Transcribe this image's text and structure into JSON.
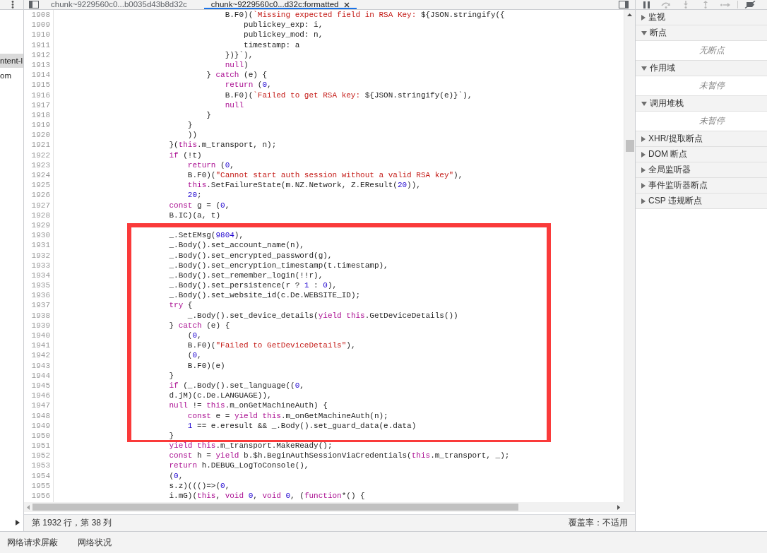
{
  "navigator": {
    "items": [
      {
        "label": "ntent-l",
        "selected": true
      },
      {
        "label": "om",
        "selected": false
      }
    ]
  },
  "editor": {
    "tabs": [
      {
        "label": "chunk~9229560c0...b0035d43b8d32c",
        "selected": false
      },
      {
        "label": "chunk~9229560c0...d32c:formatted",
        "selected": true
      }
    ],
    "lines": [
      {
        "number": "1908",
        "tokens": [
          {
            "kind": "plain",
            "text": "\t\t\t\t\t\t\t\t\tB.F0)("
          },
          {
            "kind": "string",
            "text": "`Missing expected field in RSA Key: "
          },
          {
            "kind": "plain",
            "text": "${JSON.stringify({"
          }
        ]
      },
      {
        "number": "1909",
        "tokens": [
          {
            "kind": "plain",
            "text": "\t\t\t\t\t\t\t\t\t\tpublickey_exp: i,"
          }
        ]
      },
      {
        "number": "1910",
        "tokens": [
          {
            "kind": "plain",
            "text": "\t\t\t\t\t\t\t\t\t\tpublickey_mod: n,"
          }
        ]
      },
      {
        "number": "1911",
        "tokens": [
          {
            "kind": "plain",
            "text": "\t\t\t\t\t\t\t\t\t\ttimestamp: a"
          }
        ]
      },
      {
        "number": "1912",
        "tokens": [
          {
            "kind": "plain",
            "text": "\t\t\t\t\t\t\t\t\t})}`),"
          }
        ]
      },
      {
        "number": "1913",
        "tokens": [
          {
            "kind": "keyword",
            "text": "\t\t\t\t\t\t\t\t\tnull"
          },
          {
            "kind": "plain",
            "text": ")"
          }
        ]
      },
      {
        "number": "1914",
        "tokens": [
          {
            "kind": "plain",
            "text": "\t\t\t\t\t\t\t\t} "
          },
          {
            "kind": "keyword",
            "text": "catch"
          },
          {
            "kind": "plain",
            "text": " (e) {"
          }
        ]
      },
      {
        "number": "1915",
        "tokens": [
          {
            "kind": "keyword",
            "text": "\t\t\t\t\t\t\t\t\treturn"
          },
          {
            "kind": "plain",
            "text": " ("
          },
          {
            "kind": "number",
            "text": "0"
          },
          {
            "kind": "plain",
            "text": ","
          }
        ]
      },
      {
        "number": "1916",
        "tokens": [
          {
            "kind": "plain",
            "text": "\t\t\t\t\t\t\t\t\tB.F0)("
          },
          {
            "kind": "string",
            "text": "`Failed to get RSA key: "
          },
          {
            "kind": "plain",
            "text": "${JSON.stringify(e)}`),"
          }
        ]
      },
      {
        "number": "1917",
        "tokens": [
          {
            "kind": "keyword",
            "text": "\t\t\t\t\t\t\t\t\tnull"
          }
        ]
      },
      {
        "number": "1918",
        "tokens": [
          {
            "kind": "plain",
            "text": "\t\t\t\t\t\t\t\t}"
          }
        ]
      },
      {
        "number": "1919",
        "tokens": [
          {
            "kind": "plain",
            "text": "\t\t\t\t\t\t\t}"
          }
        ]
      },
      {
        "number": "1920",
        "tokens": [
          {
            "kind": "plain",
            "text": "\t\t\t\t\t\t\t))"
          }
        ]
      },
      {
        "number": "1921",
        "tokens": [
          {
            "kind": "plain",
            "text": "\t\t\t\t\t\t}("
          },
          {
            "kind": "keyword",
            "text": "this"
          },
          {
            "kind": "plain",
            "text": ".m_transport, n);"
          }
        ]
      },
      {
        "number": "1922",
        "tokens": [
          {
            "kind": "keyword",
            "text": "\t\t\t\t\t\tif"
          },
          {
            "kind": "plain",
            "text": " (!t)"
          }
        ]
      },
      {
        "number": "1923",
        "tokens": [
          {
            "kind": "keyword",
            "text": "\t\t\t\t\t\t\treturn"
          },
          {
            "kind": "plain",
            "text": " ("
          },
          {
            "kind": "number",
            "text": "0"
          },
          {
            "kind": "plain",
            "text": ","
          }
        ]
      },
      {
        "number": "1924",
        "tokens": [
          {
            "kind": "plain",
            "text": "\t\t\t\t\t\t\tB.F0)("
          },
          {
            "kind": "string",
            "text": "\"Cannot start auth session without a valid RSA key\""
          },
          {
            "kind": "plain",
            "text": "),"
          }
        ]
      },
      {
        "number": "1925",
        "tokens": [
          {
            "kind": "keyword",
            "text": "\t\t\t\t\t\t\tthis"
          },
          {
            "kind": "plain",
            "text": ".SetFailureState(m.NZ.Network, Z.EResult("
          },
          {
            "kind": "number",
            "text": "20"
          },
          {
            "kind": "plain",
            "text": ")),"
          }
        ]
      },
      {
        "number": "1926",
        "tokens": [
          {
            "kind": "number",
            "text": "\t\t\t\t\t\t\t20"
          },
          {
            "kind": "plain",
            "text": ";"
          }
        ]
      },
      {
        "number": "1927",
        "tokens": [
          {
            "kind": "keyword",
            "text": "\t\t\t\t\t\tconst"
          },
          {
            "kind": "plain",
            "text": " g = ("
          },
          {
            "kind": "number",
            "text": "0"
          },
          {
            "kind": "plain",
            "text": ","
          }
        ]
      },
      {
        "number": "1928",
        "tokens": [
          {
            "kind": "plain",
            "text": "\t\t\t\t\t\tB.IC)(a, t)"
          }
        ]
      },
      {
        "number": "1929"
      },
      {
        "number": "1930",
        "tokens": [
          {
            "kind": "plain",
            "text": "\t\t\t\t\t\t_.SetEMsg("
          },
          {
            "kind": "number",
            "text": "9804"
          },
          {
            "kind": "plain",
            "text": "),"
          }
        ]
      },
      {
        "number": "1931",
        "tokens": [
          {
            "kind": "plain",
            "text": "\t\t\t\t\t\t_.Body().set_account_name(n),"
          }
        ]
      },
      {
        "number": "1932",
        "tokens": [
          {
            "kind": "plain",
            "text": "\t\t\t\t\t\t_.Body().set_encrypted_password(g),"
          }
        ]
      },
      {
        "number": "1933",
        "tokens": [
          {
            "kind": "plain",
            "text": "\t\t\t\t\t\t_.Body().set_encryption_timestamp(t.timestamp),"
          }
        ]
      },
      {
        "number": "1934",
        "tokens": [
          {
            "kind": "plain",
            "text": "\t\t\t\t\t\t_.Body().set_remember_login(!!r),"
          }
        ]
      },
      {
        "number": "1935",
        "tokens": [
          {
            "kind": "plain",
            "text": "\t\t\t\t\t\t_.Body().set_persistence(r ? "
          },
          {
            "kind": "number",
            "text": "1"
          },
          {
            "kind": "plain",
            "text": " : "
          },
          {
            "kind": "number",
            "text": "0"
          },
          {
            "kind": "plain",
            "text": "),"
          }
        ]
      },
      {
        "number": "1936",
        "tokens": [
          {
            "kind": "plain",
            "text": "\t\t\t\t\t\t_.Body().set_website_id(c.De.WEBSITE_ID);"
          }
        ]
      },
      {
        "number": "1937",
        "tokens": [
          {
            "kind": "keyword",
            "text": "\t\t\t\t\t\ttry"
          },
          {
            "kind": "plain",
            "text": " {"
          }
        ]
      },
      {
        "number": "1938",
        "tokens": [
          {
            "kind": "plain",
            "text": "\t\t\t\t\t\t\t_.Body().set_device_details("
          },
          {
            "kind": "keyword",
            "text": "yield this"
          },
          {
            "kind": "plain",
            "text": ".GetDeviceDetails())"
          }
        ]
      },
      {
        "number": "1939",
        "tokens": [
          {
            "kind": "plain",
            "text": "\t\t\t\t\t\t} "
          },
          {
            "kind": "keyword",
            "text": "catch"
          },
          {
            "kind": "plain",
            "text": " (e) {"
          }
        ]
      },
      {
        "number": "1940",
        "tokens": [
          {
            "kind": "plain",
            "text": "\t\t\t\t\t\t\t("
          },
          {
            "kind": "number",
            "text": "0"
          },
          {
            "kind": "plain",
            "text": ","
          }
        ]
      },
      {
        "number": "1941",
        "tokens": [
          {
            "kind": "plain",
            "text": "\t\t\t\t\t\t\tB.F0)("
          },
          {
            "kind": "string",
            "text": "\"Failed to GetDeviceDetails\""
          },
          {
            "kind": "plain",
            "text": "),"
          }
        ]
      },
      {
        "number": "1942",
        "tokens": [
          {
            "kind": "plain",
            "text": "\t\t\t\t\t\t\t("
          },
          {
            "kind": "number",
            "text": "0"
          },
          {
            "kind": "plain",
            "text": ","
          }
        ]
      },
      {
        "number": "1943",
        "tokens": [
          {
            "kind": "plain",
            "text": "\t\t\t\t\t\t\tB.F0)(e)"
          }
        ]
      },
      {
        "number": "1944",
        "tokens": [
          {
            "kind": "plain",
            "text": "\t\t\t\t\t\t}"
          }
        ]
      },
      {
        "number": "1945",
        "tokens": [
          {
            "kind": "keyword",
            "text": "\t\t\t\t\t\tif"
          },
          {
            "kind": "plain",
            "text": " (_.Body().set_language(("
          },
          {
            "kind": "number",
            "text": "0"
          },
          {
            "kind": "plain",
            "text": ","
          }
        ]
      },
      {
        "number": "1946",
        "tokens": [
          {
            "kind": "plain",
            "text": "\t\t\t\t\t\td.jM)(c.De.LANGUAGE)),"
          }
        ]
      },
      {
        "number": "1947",
        "tokens": [
          {
            "kind": "keyword",
            "text": "\t\t\t\t\t\tnull"
          },
          {
            "kind": "plain",
            "text": " != "
          },
          {
            "kind": "keyword",
            "text": "this"
          },
          {
            "kind": "plain",
            "text": ".m_onGetMachineAuth) {"
          }
        ]
      },
      {
        "number": "1948",
        "tokens": [
          {
            "kind": "keyword",
            "text": "\t\t\t\t\t\t\tconst"
          },
          {
            "kind": "plain",
            "text": " e = "
          },
          {
            "kind": "keyword",
            "text": "yield this"
          },
          {
            "kind": "plain",
            "text": ".m_onGetMachineAuth(n);"
          }
        ]
      },
      {
        "number": "1949",
        "tokens": [
          {
            "kind": "number",
            "text": "\t\t\t\t\t\t\t1"
          },
          {
            "kind": "plain",
            "text": " == e.eresult && _.Body().set_guard_data(e.data)"
          }
        ]
      },
      {
        "number": "1950",
        "tokens": [
          {
            "kind": "plain",
            "text": "\t\t\t\t\t\t}"
          }
        ]
      },
      {
        "number": "1951",
        "tokens": [
          {
            "kind": "keyword",
            "text": "\t\t\t\t\t\tyield this"
          },
          {
            "kind": "plain",
            "text": ".m_transport.MakeReady();"
          }
        ]
      },
      {
        "number": "1952",
        "tokens": [
          {
            "kind": "keyword",
            "text": "\t\t\t\t\t\tconst"
          },
          {
            "kind": "plain",
            "text": " h = "
          },
          {
            "kind": "keyword",
            "text": "yield"
          },
          {
            "kind": "plain",
            "text": " b.$h.BeginAuthSessionViaCredentials("
          },
          {
            "kind": "keyword",
            "text": "this"
          },
          {
            "kind": "plain",
            "text": ".m_transport, _);"
          }
        ]
      },
      {
        "number": "1953",
        "tokens": [
          {
            "kind": "keyword",
            "text": "\t\t\t\t\t\treturn"
          },
          {
            "kind": "plain",
            "text": " h.DEBUG_LogToConsole(),"
          }
        ]
      },
      {
        "number": "1954",
        "tokens": [
          {
            "kind": "plain",
            "text": "\t\t\t\t\t\t("
          },
          {
            "kind": "number",
            "text": "0"
          },
          {
            "kind": "plain",
            "text": ","
          }
        ]
      },
      {
        "number": "1955",
        "tokens": [
          {
            "kind": "plain",
            "text": "\t\t\t\t\t\ts.z)((()=>("
          },
          {
            "kind": "number",
            "text": "0"
          },
          {
            "kind": "plain",
            "text": ","
          }
        ]
      },
      {
        "number": "1956",
        "tokens": [
          {
            "kind": "plain",
            "text": "\t\t\t\t\t\ti.mG)("
          },
          {
            "kind": "keyword",
            "text": "this"
          },
          {
            "kind": "plain",
            "text": ", "
          },
          {
            "kind": "keyword",
            "text": "void"
          },
          {
            "kind": "number",
            "text": " 0"
          },
          {
            "kind": "plain",
            "text": ", "
          },
          {
            "kind": "keyword",
            "text": "void"
          },
          {
            "kind": "number",
            "text": " 0"
          },
          {
            "kind": "plain",
            "text": ", ("
          },
          {
            "kind": "keyword",
            "text": "function"
          },
          {
            "kind": "plain",
            "text": "*() {"
          }
        ]
      }
    ],
    "status": {
      "position": "第 1932 行，第 38 列",
      "coverage": "覆盖率：不适用"
    }
  },
  "debugger": {
    "toolbar": [
      {
        "kind": "pause",
        "disabled": false
      },
      {
        "kind": "step_over",
        "disabled": true
      },
      {
        "kind": "step_into",
        "disabled": true
      },
      {
        "kind": "step_out",
        "disabled": true
      },
      {
        "kind": "step",
        "disabled": true
      },
      {
        "kind": "deactivate_breakpoints",
        "disabled": false
      }
    ],
    "sections": [
      {
        "title": "监视",
        "expanded": false
      },
      {
        "title": "断点",
        "expanded": true,
        "message": "无断点"
      },
      {
        "title": "作用域",
        "expanded": true,
        "message": "未暂停"
      },
      {
        "title": "调用堆栈",
        "expanded": true,
        "message": "未暂停"
      },
      {
        "title": "XHR/提取断点",
        "expanded": false
      },
      {
        "title": "DOM 断点",
        "expanded": false
      },
      {
        "title": "全局监听器",
        "expanded": false
      },
      {
        "title": "事件监听器断点",
        "expanded": false
      },
      {
        "title": "CSP 违规断点",
        "expanded": false
      }
    ]
  },
  "drawer": {
    "tabs": [
      {
        "label": "网络请求屏蔽",
        "selected": false
      },
      {
        "label": "网络状况",
        "selected": false
      }
    ]
  }
}
